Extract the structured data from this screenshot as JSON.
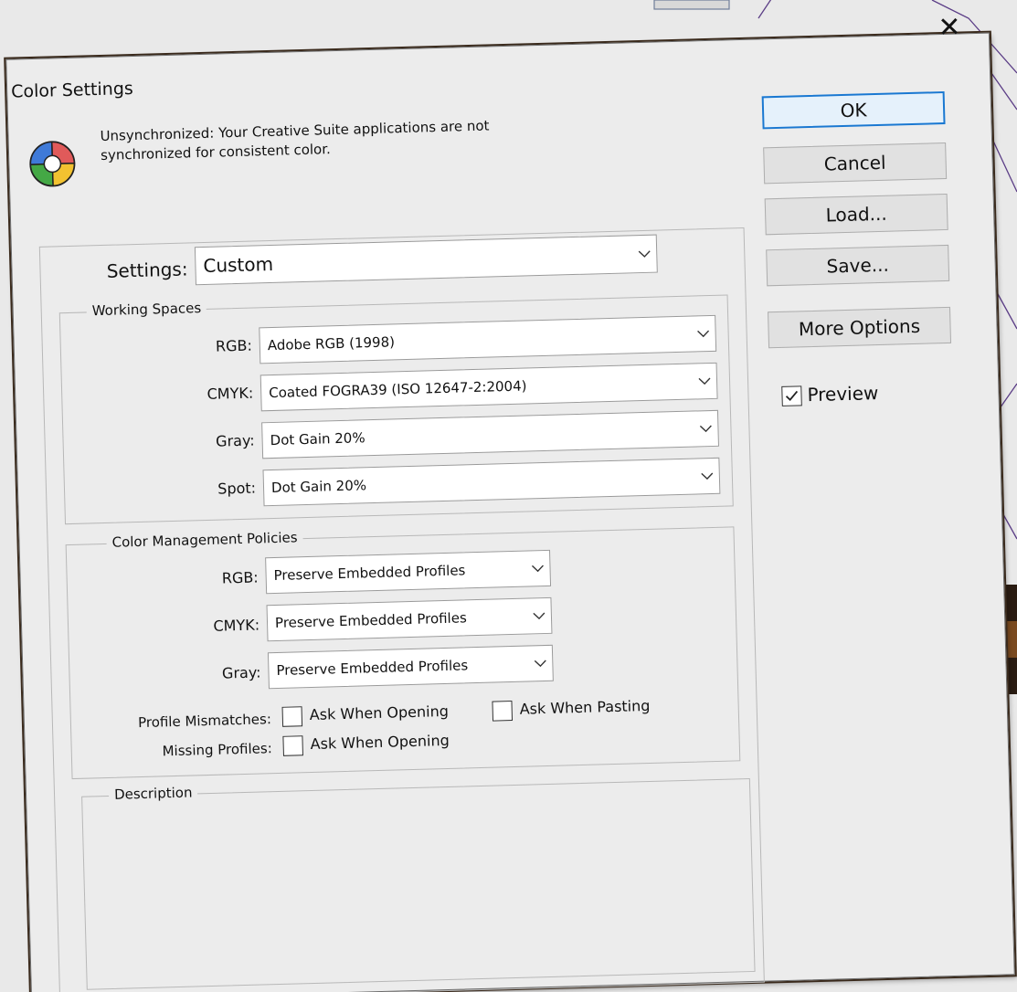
{
  "dialog": {
    "title": "Color Settings",
    "sync_message": "Unsynchronized: Your Creative Suite applications are not synchronized for consistent color."
  },
  "settings": {
    "label": "Settings:",
    "value": "Custom"
  },
  "working_spaces": {
    "title": "Working Spaces",
    "rgb_label": "RGB:",
    "rgb_value": "Adobe RGB (1998)",
    "cmyk_label": "CMYK:",
    "cmyk_value": "Coated FOGRA39 (ISO 12647-2:2004)",
    "gray_label": "Gray:",
    "gray_value": "Dot Gain 20%",
    "spot_label": "Spot:",
    "spot_value": "Dot Gain 20%"
  },
  "policies": {
    "title": "Color Management Policies",
    "rgb_label": "RGB:",
    "rgb_value": "Preserve Embedded Profiles",
    "cmyk_label": "CMYK:",
    "cmyk_value": "Preserve Embedded Profiles",
    "gray_label": "Gray:",
    "gray_value": "Preserve Embedded Profiles",
    "mismatch_label": "Profile Mismatches:",
    "mismatch_opening": "Ask When Opening",
    "mismatch_pasting": "Ask When Pasting",
    "missing_label": "Missing Profiles:",
    "missing_opening": "Ask When Opening"
  },
  "description": {
    "title": "Description"
  },
  "buttons": {
    "ok": "OK",
    "cancel": "Cancel",
    "load": "Load...",
    "save": "Save...",
    "more_options": "More Options"
  },
  "preview": {
    "label": "Preview",
    "checked": true
  },
  "icons": {
    "close": "close-icon",
    "chevron": "chevron-down-icon",
    "logo": "color-settings-icon",
    "check": "checkmark-icon"
  },
  "colors": {
    "accent": "#1a78d1",
    "dialog_bg": "#ececec"
  }
}
